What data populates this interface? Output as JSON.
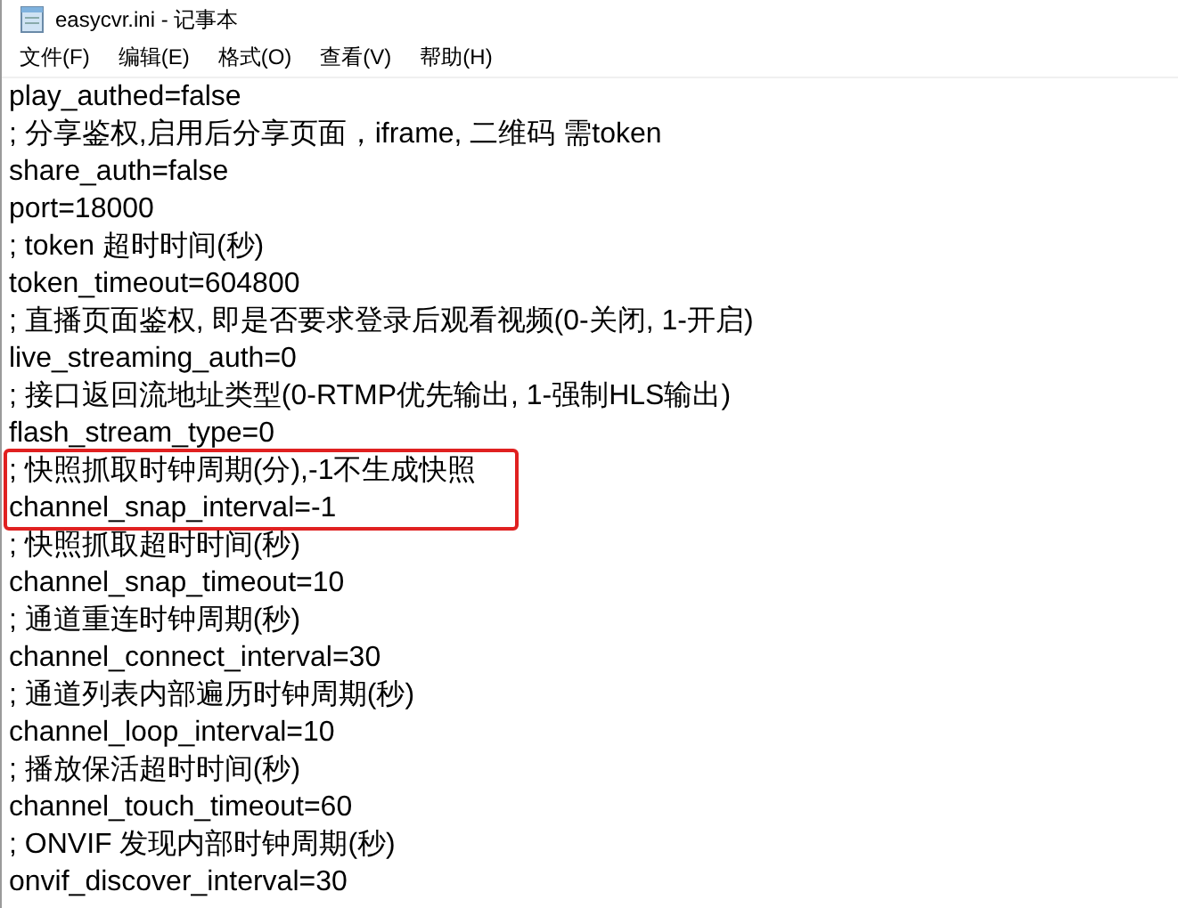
{
  "window": {
    "title": "easycvr.ini - 记事本"
  },
  "menu": [
    {
      "label": "文件(F)"
    },
    {
      "label": "编辑(E)"
    },
    {
      "label": "格式(O)"
    },
    {
      "label": "查看(V)"
    },
    {
      "label": "帮助(H)"
    }
  ],
  "lines": [
    {
      "text": "play_authed=false",
      "highlighted": false
    },
    {
      "text": "; 分享鉴权,启用后分享页面，iframe, 二维码 需token",
      "highlighted": false
    },
    {
      "text": "share_auth=false",
      "highlighted": false
    },
    {
      "text": "port=18000",
      "highlighted": false
    },
    {
      "text": "; token 超时时间(秒)",
      "highlighted": false
    },
    {
      "text": "token_timeout=604800",
      "highlighted": false
    },
    {
      "text": "; 直播页面鉴权, 即是否要求登录后观看视频(0-关闭, 1-开启)",
      "highlighted": false
    },
    {
      "text": "live_streaming_auth=0",
      "highlighted": false
    },
    {
      "text": "; 接口返回流地址类型(0-RTMP优先输出, 1-强制HLS输出)",
      "highlighted": false
    },
    {
      "text": "flash_stream_type=0",
      "highlighted": false
    },
    {
      "text": "; 快照抓取时钟周期(分),-1不生成快照",
      "highlighted": true
    },
    {
      "text": "channel_snap_interval=-1",
      "highlighted": true
    },
    {
      "text": "; 快照抓取超时时间(秒)",
      "highlighted": false
    },
    {
      "text": "channel_snap_timeout=10",
      "highlighted": false
    },
    {
      "text": "; 通道重连时钟周期(秒)",
      "highlighted": false
    },
    {
      "text": "channel_connect_interval=30",
      "highlighted": false
    },
    {
      "text": "; 通道列表内部遍历时钟周期(秒)",
      "highlighted": false
    },
    {
      "text": "channel_loop_interval=10",
      "highlighted": false
    },
    {
      "text": "; 播放保活超时时间(秒)",
      "highlighted": false
    },
    {
      "text": "channel_touch_timeout=60",
      "highlighted": false
    },
    {
      "text": "; ONVIF 发现内部时钟周期(秒)",
      "highlighted": false
    },
    {
      "text": "onvif_discover_interval=30",
      "highlighted": false
    }
  ]
}
